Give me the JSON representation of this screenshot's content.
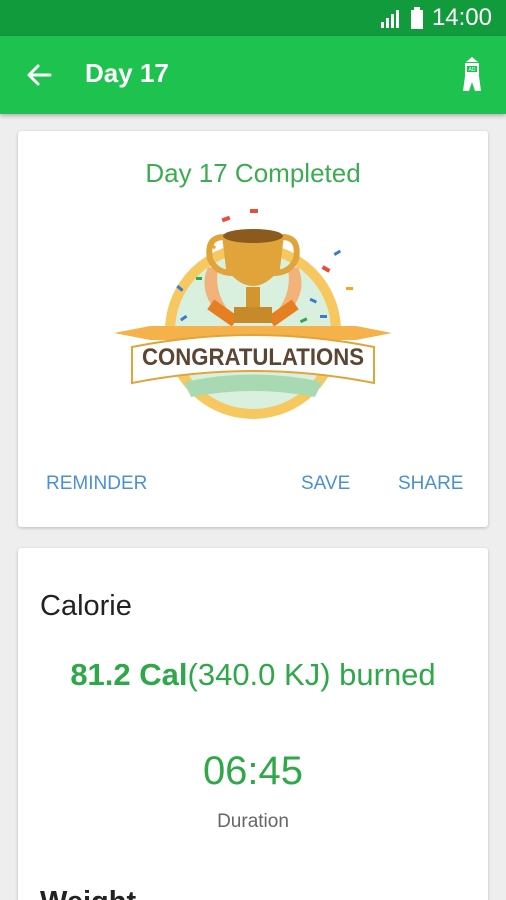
{
  "status_bar": {
    "time": "14:00",
    "signal_icon": "signal-icon",
    "battery_icon": "battery-icon"
  },
  "app_bar": {
    "title": "Day 17",
    "back_icon": "arrow-left-icon",
    "ad_icon": "ad-tower-icon"
  },
  "completion_card": {
    "title": "Day 17 Completed",
    "banner_text": "CONGRATULATIONS",
    "actions": {
      "reminder": "REMINDER",
      "save": "SAVE",
      "share": "SHARE"
    }
  },
  "stats_card": {
    "calorie_title": "Calorie",
    "calorie_value": "81.2 Cal",
    "calorie_detail": "(340.0 KJ) burned",
    "duration_value": "06:45",
    "duration_label": "Duration",
    "weight_title": "Weight"
  },
  "colors": {
    "status_bar": "#129b3d",
    "app_bar": "#1ec24f",
    "accent_green": "#2fa84a",
    "action_blue": "#4a90d9"
  }
}
